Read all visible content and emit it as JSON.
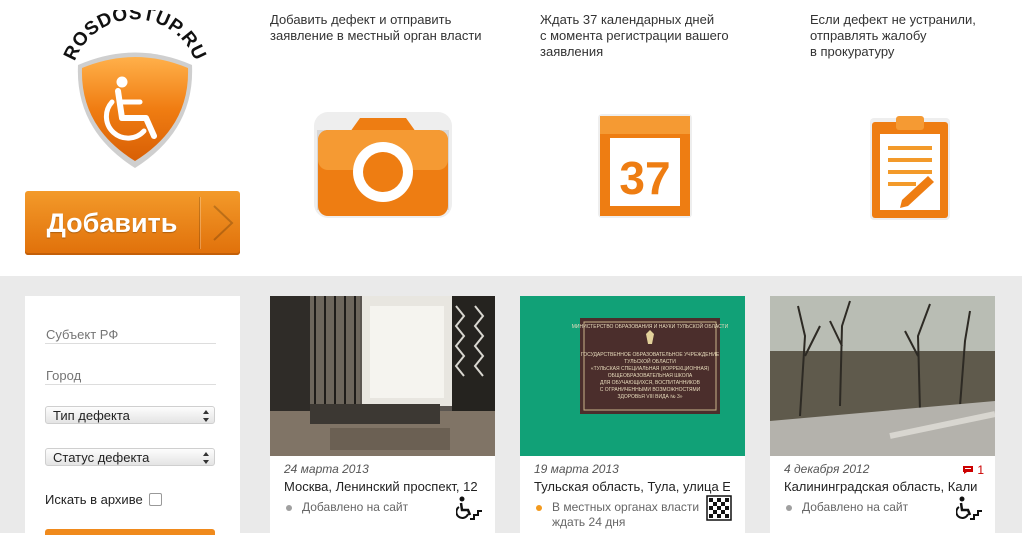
{
  "logo": {
    "text": "ROSDOSTUP.RU"
  },
  "add_button": {
    "label": "Добавить"
  },
  "steps": [
    {
      "text_lines": [
        "Добавить дефект и отправить",
        "заявление в местный орган власти"
      ]
    },
    {
      "text_lines": [
        "Ждать 37 календарных дней",
        "с момента регистрации вашего",
        "заявления"
      ],
      "calendar_number": "37"
    },
    {
      "text_lines": [
        "Если дефект не устранили,",
        "отправлять жалобу",
        "в прокуратуру"
      ]
    }
  ],
  "filter": {
    "region_placeholder": "Субъект РФ",
    "city_placeholder": "Город",
    "defect_type": "Тип дефекта",
    "defect_status": "Статус дефекта",
    "archive_label": "Искать в архиве"
  },
  "cards": [
    {
      "date": "24 марта 2013",
      "address": "Москва, Ленинский проспект, 12",
      "status": "Добавлено на сайт",
      "status_color": "#a0a0a0",
      "icon": "wheelchair-stairs-icon"
    },
    {
      "date": "19 марта 2013",
      "address": "Тульская область, Тула, улица Е",
      "status_lines": [
        "В местных органах власти",
        "ждать 24 дня"
      ],
      "status_color": "#f39a1e",
      "icon": "braille-pattern-icon",
      "sign_lines": [
        "МИНИСТЕРСТВО ОБРАЗОВАНИЯ И НАУКИ ТУЛЬСКОЙ ОБЛАСТИ",
        "ГОСУДАРСТВЕННОЕ ОБРАЗОВАТЕЛЬНОЕ УЧРЕЖДЕНИЕ",
        "ТУЛЬСКОЙ ОБЛАСТИ",
        "«ТУЛЬСКАЯ СПЕЦИАЛЬНАЯ (КОРРЕКЦИОННАЯ)",
        "ОБЩЕОБРАЗОВАТЕЛЬНАЯ ШКОЛА",
        "ДЛЯ ОБУЧАЮЩИХСЯ, ВОСПИТАННИКОВ",
        "С ОГРАНИЧЕННЫМИ ВОЗМОЖНОСТЯМИ",
        "ЗДОРОВЬЯ VIII ВИДА № 3»"
      ]
    },
    {
      "date": "4 декабря 2012",
      "address": "Калининградская область, Кали",
      "status": "Добавлено на сайт",
      "status_color": "#a0a0a0",
      "icon": "wheelchair-stairs-icon",
      "comments": "1"
    }
  ],
  "colors": {
    "accent": "#f08a1c",
    "bg_gray": "#eaeaea"
  }
}
